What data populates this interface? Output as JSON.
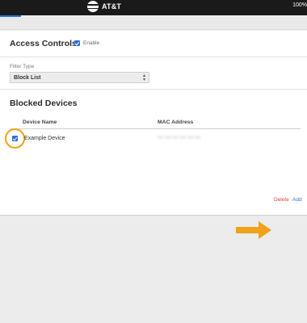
{
  "header": {
    "brand": "AT&T",
    "battery": "100%"
  },
  "access_controls": {
    "title": "Access Controls",
    "enable_label": "Enable",
    "enable_checked": true
  },
  "filter": {
    "label": "Filter Type",
    "selected": "Block List"
  },
  "blocked_devices": {
    "title": "Blocked Devices",
    "columns": [
      "Device Name",
      "MAC Address"
    ],
    "rows": [
      {
        "checked": true,
        "name": "Example Device",
        "mac": "00:00:00:00:00:00"
      }
    ]
  },
  "actions": {
    "delete_label": "Delete",
    "add_label": "Add"
  },
  "colors": {
    "accent": "#2f6fd6",
    "highlight": "#f0a318",
    "delete": "#e0413a"
  }
}
